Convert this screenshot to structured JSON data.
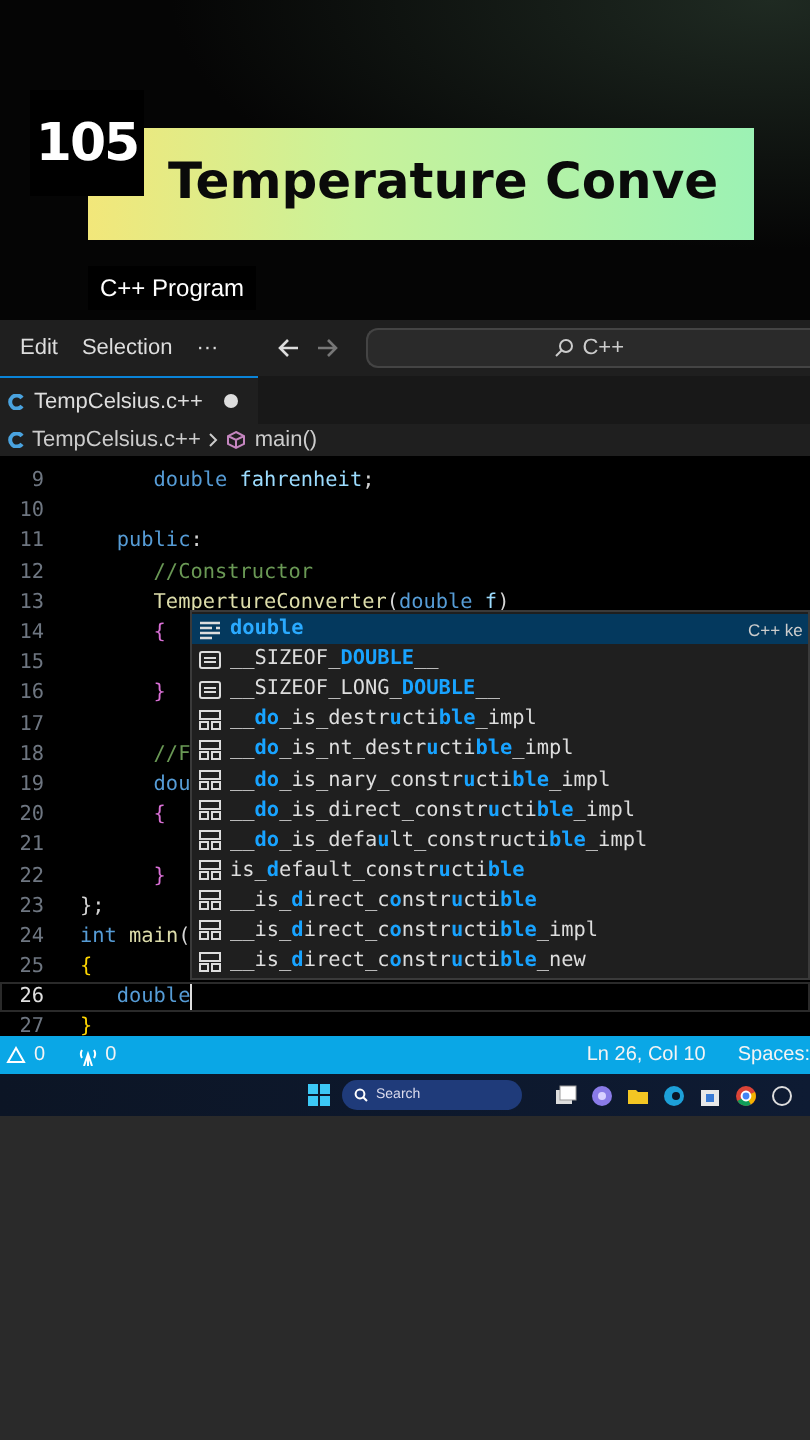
{
  "banner": {
    "number": "105",
    "title": "Temperature Conve",
    "subtitle": "C++ Program"
  },
  "menu": {
    "items": [
      "Edit",
      "Selection",
      "···"
    ],
    "search": "C++"
  },
  "tabs": [
    {
      "label": "TempCelsius.c++",
      "modified": true,
      "selected": true
    }
  ],
  "breadcrumb": [
    "TempCelsius.c++",
    "main()"
  ],
  "editor": {
    "lines": [
      {
        "number": "9",
        "current": false,
        "tokens": [
          {
            "text": "      double",
            "kind": "kw"
          },
          {
            "text": " fahrenheit",
            "kind": "var"
          },
          {
            "text": ";",
            "kind": "punct"
          }
        ]
      },
      {
        "number": "10",
        "current": false
      },
      {
        "number": "11",
        "current": false,
        "tokens": [
          {
            "text": "   public",
            "kind": "kw"
          },
          {
            "text": ":",
            "kind": "punct"
          }
        ]
      },
      {
        "number": "12",
        "current": false,
        "tokens": [
          {
            "text": "      //Constructor",
            "kind": "comment"
          }
        ]
      },
      {
        "number": "13",
        "current": false,
        "tokens": [
          {
            "text": "      TempertureConverter",
            "kind": "fn"
          },
          {
            "text": "(",
            "kind": "punct"
          },
          {
            "text": "double",
            "kind": "kw"
          },
          {
            "text": " f",
            "kind": "var"
          },
          {
            "text": ")",
            "kind": "punct"
          }
        ]
      },
      {
        "number": "14",
        "current": false,
        "tokens": [
          {
            "text": "      {",
            "kind": "brace2"
          }
        ]
      },
      {
        "number": "15",
        "current": false
      },
      {
        "number": "16",
        "current": false,
        "tokens": [
          {
            "text": "      }",
            "kind": "brace2"
          }
        ]
      },
      {
        "number": "17",
        "current": false
      },
      {
        "number": "18",
        "current": false,
        "tokens": [
          {
            "text": "      //F",
            "kind": "comment"
          }
        ]
      },
      {
        "number": "19",
        "current": false,
        "tokens": [
          {
            "text": "      dou",
            "kind": "kw"
          }
        ]
      },
      {
        "number": "20",
        "current": false,
        "tokens": [
          {
            "text": "      {",
            "kind": "brace2"
          }
        ]
      },
      {
        "number": "21",
        "current": false
      },
      {
        "number": "22",
        "current": false,
        "tokens": [
          {
            "text": "      }",
            "kind": "brace2"
          }
        ]
      },
      {
        "number": "23",
        "current": false,
        "tokens": [
          {
            "text": "};",
            "kind": "punct"
          }
        ]
      },
      {
        "number": "24",
        "current": false,
        "tokens": [
          {
            "text": "int",
            "kind": "kw"
          },
          {
            "text": " main",
            "kind": "fn"
          },
          {
            "text": "(",
            "kind": "punct"
          }
        ]
      },
      {
        "number": "25",
        "current": false,
        "tokens": [
          {
            "text": "{",
            "kind": "brace1"
          }
        ]
      },
      {
        "number": "26",
        "current": true,
        "tokens": [
          {
            "text": "   double",
            "kind": "kw"
          }
        ]
      },
      {
        "number": "27",
        "current": false,
        "tokens": [
          {
            "text": "}",
            "kind": "brace1"
          }
        ]
      }
    ]
  },
  "suggestions": [
    {
      "kind": "keyword",
      "selected": true,
      "detail": "C++ ke",
      "label": "double"
    },
    {
      "kind": "text",
      "selected": false,
      "label": "__SIZEOF_**DOUBLE**__"
    },
    {
      "kind": "text",
      "selected": false,
      "label": "__SIZEOF_LONG_**DOUBLE**__"
    },
    {
      "kind": "struct",
      "selected": false,
      "label": "__**do**_is_destr**u**cti**ble**_impl"
    },
    {
      "kind": "struct",
      "selected": false,
      "label": "__**do**_is_nt_destr**u**cti**ble**_impl"
    },
    {
      "kind": "struct",
      "selected": false,
      "label": "__**do**_is_nary_constr**u**cti**ble**_impl"
    },
    {
      "kind": "struct",
      "selected": false,
      "label": "__**do**_is_direct_constr**u**cti**ble**_impl"
    },
    {
      "kind": "struct",
      "selected": false,
      "label": "__**do**_is_defa**u**lt_constructi**ble**_impl"
    },
    {
      "kind": "struct",
      "selected": false,
      "label": "is_**d**efault_constr**u**cti**ble**"
    },
    {
      "kind": "struct",
      "selected": false,
      "label": "__is_**d**irect_c**o**nstr**u**cti**ble**"
    },
    {
      "kind": "struct",
      "selected": false,
      "label": "__is_**d**irect_c**o**nstr**u**cti**ble**_impl"
    },
    {
      "kind": "struct",
      "selected": false,
      "label": "__is_**d**irect_c**o**nstr**u**cti**ble**_new"
    }
  ],
  "status_bar": {
    "warnings": "0",
    "ports": "0",
    "position": "Ln 26, Col 10",
    "indentation": "Spaces:"
  },
  "taskbar": {
    "search": "Search"
  }
}
